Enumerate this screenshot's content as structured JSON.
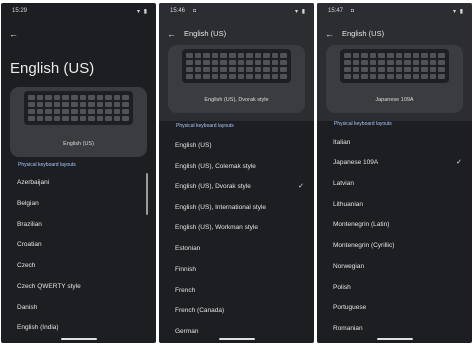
{
  "screen1": {
    "status_time": "15:29",
    "status_icons": "▾ ▮",
    "title": "English (US)",
    "keyboard_label": "English (US)",
    "section_label": "Physical keyboard layouts",
    "items": [
      "Azerbaijani",
      "Belgian",
      "Brazilian",
      "Croatian",
      "Czech",
      "Czech QWERTY style",
      "Danish",
      "English (India)"
    ]
  },
  "screen2": {
    "status_time": "15:46",
    "status_note": "◘",
    "status_icons": "▾ ▮",
    "title": "English (US)",
    "keyboard_label": "English (US), Dvorak style",
    "section_label": "Physical keyboard layouts",
    "items": [
      "English (US)",
      "English (US), Colemak style",
      "English (US), Dvorak style",
      "English (US), International style",
      "English (US), Workman style",
      "Estonian",
      "Finnish",
      "French",
      "French (Canada)",
      "German"
    ],
    "selected_index": 2
  },
  "screen3": {
    "status_time": "15:47",
    "status_note": "◘",
    "status_icons": "▾ ▮",
    "title": "English (US)",
    "keyboard_label": "Japanese 109A",
    "section_label": "Physical keyboard layouts",
    "items": [
      "Italian",
      "Japanese 109A",
      "Latvian",
      "Lithuanian",
      "Montenegrin (Latin)",
      "Montenegrin (Cyrillic)",
      "Norwegian",
      "Polish",
      "Portuguese",
      "Romanian"
    ],
    "selected_index": 1
  },
  "icons": {
    "back": "back-arrow-icon",
    "check": "check-icon"
  },
  "colors": {
    "background": "#1c1e21",
    "accent": "#a7c8ff",
    "card": "#3a3c40"
  }
}
